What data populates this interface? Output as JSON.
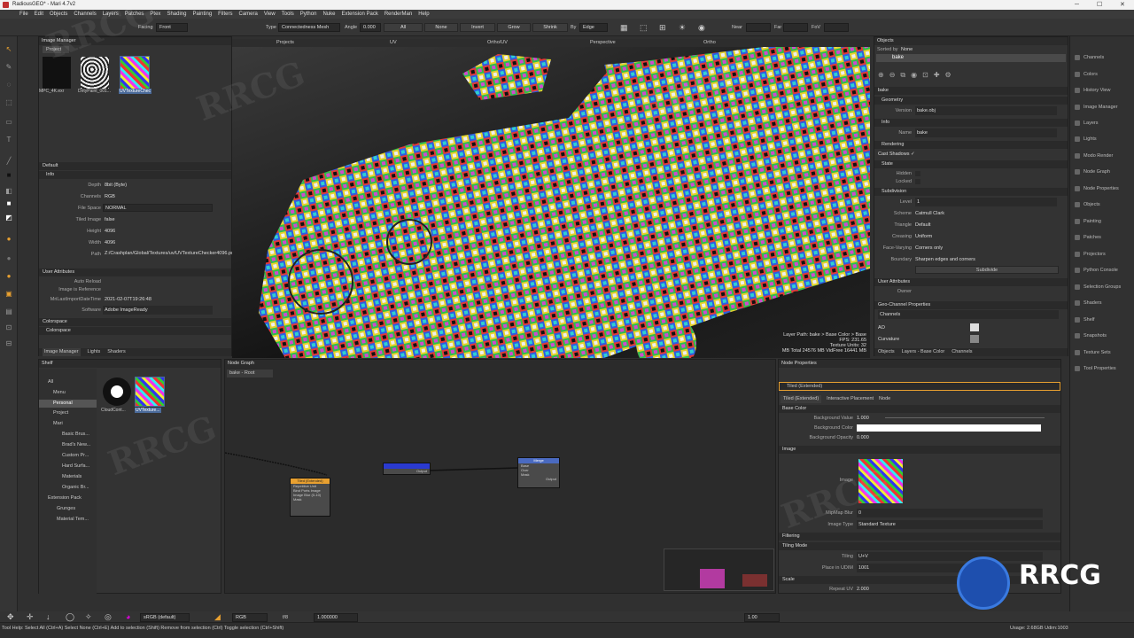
{
  "window": {
    "title": "RadiousGEO* - Mari 4.7v2"
  },
  "menu": [
    "File",
    "Edit",
    "Objects",
    "Channels",
    "Layers",
    "Patches",
    "Ptex",
    "Shading",
    "Painting",
    "Filters",
    "Camera",
    "View",
    "Tools",
    "Python",
    "Nuke",
    "Extension Pack",
    "RenderMan",
    "Help"
  ],
  "toolbar": {
    "facing_label": "Facing",
    "facing_value": "Front",
    "type_label": "Type",
    "type_value": "Connectedness Mesh",
    "angle_label": "Angle",
    "angle_value": "0.000",
    "all": "All",
    "none": "None",
    "invert": "Invert",
    "grow": "Grow",
    "shrink": "Shrink",
    "by_label": "By",
    "by_value": "Edge",
    "near_label": "Near",
    "far_label": "Far",
    "fov_label": "FoV"
  },
  "image_manager": {
    "title": "Image Manager",
    "tab": "Project",
    "images": [
      {
        "name": "MPC_4K.exr"
      },
      {
        "name": "DirtyPaint_001..."
      },
      {
        "name": "UVTextureChec"
      }
    ],
    "default_section": "Default",
    "info_section": "Info",
    "props": [
      {
        "label": "Depth",
        "value": "8bit (Byte)"
      },
      {
        "label": "Channels",
        "value": "RGB"
      },
      {
        "label": "File Space",
        "value": "NORMAL"
      },
      {
        "label": "Tiled Image",
        "value": "false"
      },
      {
        "label": "Height",
        "value": "4096"
      },
      {
        "label": "Width",
        "value": "4096"
      },
      {
        "label": "Path",
        "value": "Z:/Crashplan/Global/Textures/uv/UVTextureChecker4096.png"
      }
    ],
    "user_attr_section": "User Attributes",
    "user_attrs": [
      {
        "label": "Auto Reload",
        "value": ""
      },
      {
        "label": "Image is Reference",
        "value": ""
      },
      {
        "label": "MriLastImportDateTime",
        "value": "2021-02-07T19:26:48"
      },
      {
        "label": "Software",
        "value": "Adobe ImageReady"
      }
    ],
    "colorspace_section": "Colorspace",
    "colorspace_sub": "Colorspace",
    "bottom_tabs": [
      "Image Manager",
      "Lights",
      "Shaders"
    ]
  },
  "viewport": {
    "tabs": [
      "Projects",
      "UV",
      "Ortho/UV",
      "Perspective",
      "Ortho"
    ],
    "hud": [
      "Layer Path: bake > Base Color > Base",
      "FPS: 231.65",
      "Texture Units: 32",
      "MB Total 24576 MB VidFree 16441 MB"
    ]
  },
  "objects_panel": {
    "title": "Objects",
    "sorted_by": "Sorted by",
    "sorted_value": "None",
    "object": "bake",
    "bake_section": "bake",
    "geometry": "Geometry",
    "version_label": "Version",
    "version_value": "bake.obj",
    "info": "Info",
    "name_label": "Name",
    "name_value": "bake",
    "rendering": "Rendering",
    "cast_shadows": "Cast Shadows ✓",
    "state": "State",
    "hidden": "Hidden",
    "locked": "Locked",
    "subdivision": "Subdivision",
    "level_label": "Level",
    "level_value": "1",
    "scheme_label": "Scheme",
    "scheme_value": "Catmull Clark",
    "triangle_label": "Triangle",
    "triangle_value": "Default",
    "creasing_label": "Creasing",
    "creasing_value": "Uniform",
    "facevarying_label": "Face-Varying",
    "facevarying_value": "Corners only",
    "boundary_label": "Boundary",
    "boundary_value": "Sharpen edges and corners",
    "subdivide_btn": "Subdivide",
    "user_attrs": "User Attributes",
    "owner": "Owner",
    "geo_channel": "Geo-Channel Properties",
    "channels_label": "Channels",
    "ao": "AO",
    "curvature": "Curvature",
    "bottom_tabs": [
      "Objects",
      "Layers - Base Color",
      "Channels"
    ]
  },
  "right_dock": [
    "Channels",
    "Colors",
    "History View",
    "Image Manager",
    "Layers",
    "Lights",
    "Modo Render",
    "Node Graph",
    "Node Properties",
    "Objects",
    "Painting",
    "Patches",
    "Projectors",
    "Python Console",
    "Selection Groups",
    "Shaders",
    "Shelf",
    "Snapshots",
    "Texture Sets",
    "Tool Properties"
  ],
  "shelf": {
    "title": "Shelf",
    "tree": [
      "All",
      "Menu",
      "Personal",
      "Project",
      "Mari",
      "Basic Brus...",
      "Brad's New...",
      "Custom Pr...",
      "Hard Surfa...",
      "Materials",
      "Organic Br...",
      "Extension Pack",
      "Grunges",
      "Material Tem..."
    ],
    "items": [
      {
        "name": "CloudCont..."
      },
      {
        "name": "UVTexture..."
      }
    ]
  },
  "node_graph": {
    "title": "Node Graph",
    "breadcrumb": "bake - Root",
    "nodes": [
      {
        "title": "Tiled (Extended)",
        "ports": [
          "Repetitive Unit",
          "Bind Ports Image",
          "Image Blur (0-10)",
          "Mask"
        ]
      },
      {
        "title": "",
        "ports": [
          "Output"
        ]
      },
      {
        "title": "Merge",
        "ports": [
          "Base",
          "Over",
          "Mask",
          "Output"
        ]
      }
    ]
  },
  "node_properties": {
    "title": "Node Properties",
    "section": "Tiled (Extended)",
    "tabs": [
      "Tiled (Extended)",
      "Interactive Placement",
      "Node"
    ],
    "base_color": "Base Color",
    "bg_value_label": "Background Value",
    "bg_value": "1.000",
    "bg_color_label": "Background Color",
    "bg_opacity_label": "Background Opacity",
    "bg_opacity": "0.000",
    "image_section": "Image",
    "image_label": "Image",
    "mipmap_label": "MipMap Blur",
    "mipmap_value": "0",
    "image_type_label": "Image Type",
    "image_type_value": "Standard Texture",
    "filtering": "Filtering",
    "tiling_mode": "Tiling Mode",
    "tiling_label": "Tiling",
    "tiling_value": "U+V",
    "place_label": "Place in UDIM",
    "place_value": "1001",
    "scale": "Scale",
    "repeat_label": "Repeat UV",
    "repeat_value": "2.000"
  },
  "status": {
    "colorspace": "sRGB (default)",
    "channel": "RGB",
    "fstop": "f/8",
    "exposure": "1.000000",
    "gamma": "1.00",
    "help": "Tool Help:  Select All (Ctrl+A)     Select None (Ctrl+E)     Add to selection (Shift)     Remove from selection (Ctrl)     Toggle selection (Ctrl+Shift)",
    "memory": "Usage: 2.68GB  Udim:1003"
  },
  "colors": {
    "accent": "#e8a030",
    "panel": "#333333",
    "selected": "#4a6a9a"
  }
}
